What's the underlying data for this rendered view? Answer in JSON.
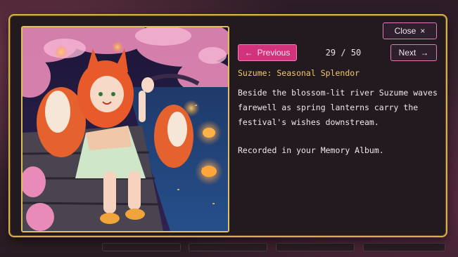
{
  "dialog": {
    "close_label": "Close",
    "close_icon": "×",
    "prev_label": "Previous",
    "prev_icon": "←",
    "next_label": "Next",
    "next_icon": "→",
    "counter": "29 / 50",
    "title": "Suzume: Seasonal Splendor",
    "description": "Beside the blossom-lit river Suzume waves farewell as spring lanterns carry the festival's wishes downstream.",
    "note": "Recorded in your Memory Album.",
    "artwork_icon": "fox-girl-illustration"
  },
  "colors": {
    "frame_gold": "#d6b04a",
    "accent_pink": "#d2337c",
    "title_gold": "#f2c86a",
    "panel_bg": "#231a20"
  }
}
